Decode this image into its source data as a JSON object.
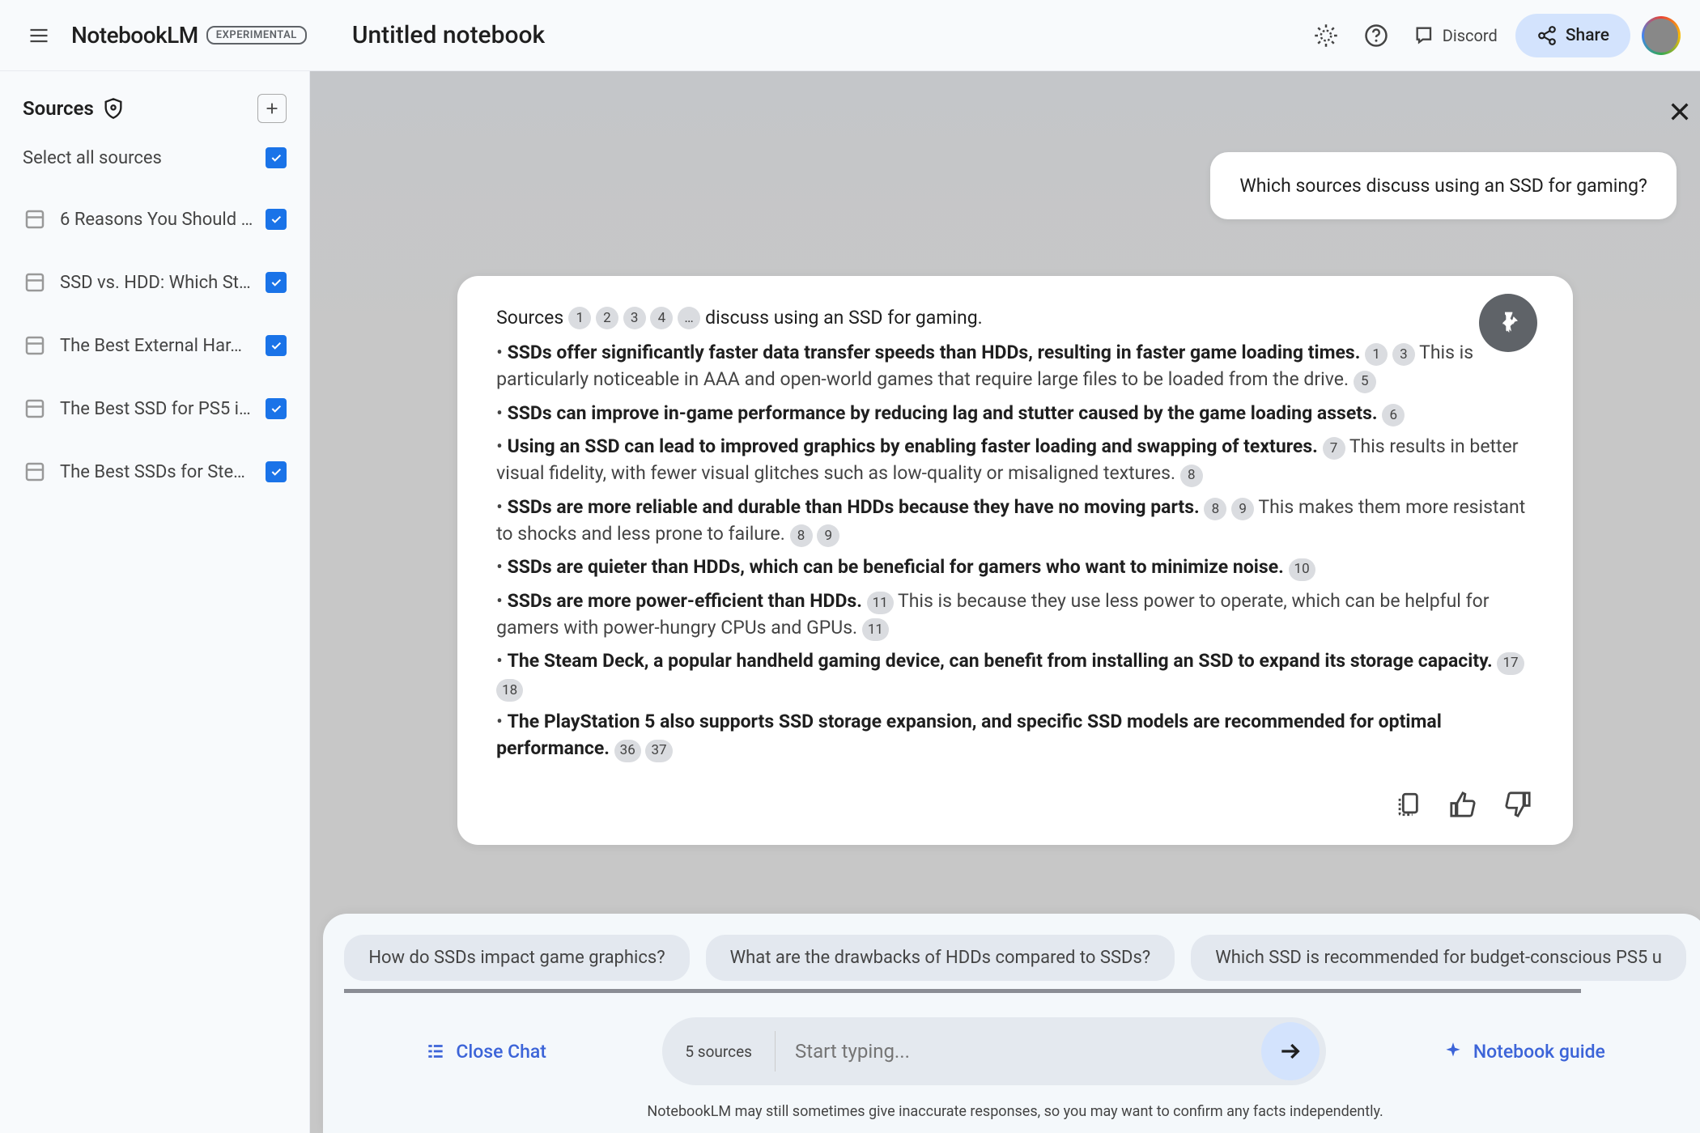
{
  "header": {
    "app_name": "NotebookLM",
    "experimental_label": "EXPERIMENTAL",
    "notebook_title": "Untitled notebook",
    "discord_label": "Discord",
    "share_label": "Share"
  },
  "sidebar": {
    "title": "Sources",
    "select_all_label": "Select all sources",
    "sources": [
      {
        "name": "6 Reasons You Should …",
        "checked": true
      },
      {
        "name": "SSD vs. HDD: Which St…",
        "checked": true
      },
      {
        "name": "The Best External Har…",
        "checked": true
      },
      {
        "name": "The Best SSD for PS5 i…",
        "checked": true
      },
      {
        "name": "The Best SSDs for Ste…",
        "checked": true
      }
    ]
  },
  "chat": {
    "user_message": "Which sources discuss using an SSD for gaming?",
    "intro_prefix": "Sources",
    "intro_cites": [
      "1",
      "2",
      "3",
      "4",
      "…"
    ],
    "intro_suffix": "discuss using an SSD for gaming.",
    "bullets": [
      {
        "bold": "SSDs offer significantly faster data transfer speeds than HDDs, resulting in faster game loading times.",
        "cites": [
          "1",
          "3"
        ],
        "tail": "This is particularly noticeable in AAA and open-world games that require large files to be loaded from the drive.",
        "tail_cites": [
          "5"
        ]
      },
      {
        "bold": "SSDs can improve in-game performance by reducing lag and stutter caused by the game loading assets.",
        "cites": [
          "6"
        ],
        "tail": "",
        "tail_cites": []
      },
      {
        "bold": "Using an SSD can lead to improved graphics by enabling faster loading and swapping of textures.",
        "cites": [
          "7"
        ],
        "tail": "This results in better visual fidelity, with fewer visual glitches such as low-quality or misaligned textures.",
        "tail_cites": [
          "8"
        ]
      },
      {
        "bold": "SSDs are more reliable and durable than HDDs because they have no moving parts.",
        "cites": [
          "8",
          "9"
        ],
        "tail": "This makes them more resistant to shocks and less prone to failure.",
        "tail_cites": [
          "8",
          "9"
        ]
      },
      {
        "bold": "SSDs are quieter than HDDs, which can be beneficial for gamers who want to minimize noise.",
        "cites": [
          "10"
        ],
        "tail": "",
        "tail_cites": []
      },
      {
        "bold": "SSDs are more power-efficient than HDDs.",
        "cites": [
          "11"
        ],
        "tail": "This is because they use less power to operate, which can be helpful for gamers with power-hungry CPUs and GPUs.",
        "tail_cites": [
          "11"
        ]
      },
      {
        "bold": "The Steam Deck, a popular handheld gaming device, can benefit from installing an SSD to expand its storage capacity.",
        "cites": [],
        "tail": "",
        "tail_cites": [
          "17",
          "18"
        ]
      },
      {
        "bold": "The PlayStation 5 also supports SSD storage expansion, and specific SSD models are recommended for optimal performance.",
        "cites": [],
        "tail": "",
        "tail_cites": [
          "36",
          "37"
        ]
      }
    ]
  },
  "suggestions": [
    "How do SSDs impact game graphics?",
    "What are the drawbacks of HDDs compared to SSDs?",
    "Which SSD is recommended for budget-conscious PS5 u"
  ],
  "footer": {
    "close_chat_label": "Close Chat",
    "sources_count": "5 sources",
    "input_placeholder": "Start typing...",
    "guide_label": "Notebook guide",
    "disclaimer": "NotebookLM may still sometimes give inaccurate responses, so you may want to confirm any facts independently."
  }
}
